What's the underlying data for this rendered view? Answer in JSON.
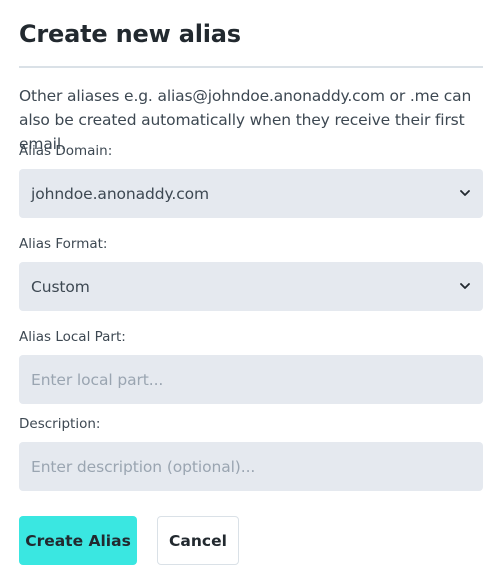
{
  "modal": {
    "title": "Create new alias",
    "help_text": "Other aliases e.g. alias@johndoe.anonaddy.com or .me can also be created automatically when they receive their first email."
  },
  "fields": {
    "alias_domain": {
      "label": "Alias Domain:",
      "value": "johndoe.anonaddy.com"
    },
    "alias_format": {
      "label": "Alias Format:",
      "value": "Custom"
    },
    "alias_local_part": {
      "label": "Alias Local Part:",
      "placeholder": "Enter local part..."
    },
    "description": {
      "label": "Description:",
      "placeholder": "Enter description (optional)..."
    }
  },
  "buttons": {
    "create_label": "Create Alias",
    "cancel_label": "Cancel"
  },
  "colors": {
    "primary_accent": "#3ae7e1",
    "field_background": "#e5e9ef",
    "divider": "#dae1e7"
  },
  "icons": {
    "select_chevron": "chevron-down-icon"
  }
}
